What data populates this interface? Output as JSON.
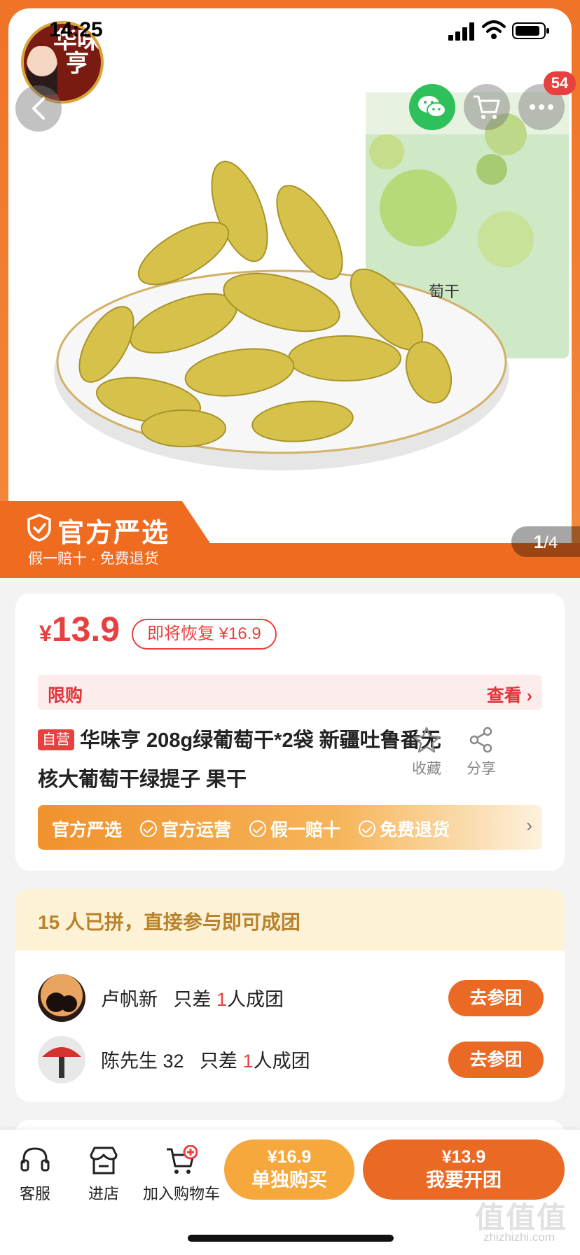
{
  "status_bar": {
    "time": "14:25"
  },
  "header": {
    "logo_text": "华味亨",
    "cart_badge": "54",
    "icons": [
      "back-icon",
      "wechat-icon",
      "cart-icon",
      "more-icon"
    ]
  },
  "hero": {
    "banner_title": "官方严选",
    "banner_sub": "假一赔十 · 免费退货",
    "pager_current": "1",
    "pager_total": "/4",
    "package_text": "萄干"
  },
  "price_card": {
    "currency": "¥",
    "price": "13.9",
    "restore_tag": "即将恢复 ¥16.9",
    "limit_label": "限购",
    "limit_view": "查看 ›",
    "self_tag": "自营",
    "title": "华味亨 208g绿葡萄干*2袋 新疆吐鲁番无核大葡萄干绿提子 果干",
    "favorite_label": "收藏",
    "share_label": "分享",
    "promo": {
      "brand": "官方严选",
      "items": [
        "官方运营",
        "假一赔十",
        "免费退货"
      ],
      "arrow": "›"
    }
  },
  "group_card": {
    "header": "15 人已拼，直接参与即可成团",
    "rows": [
      {
        "name": "卢帆新",
        "prefix": "只差",
        "count": "1",
        "suffix": "人成团",
        "button": "去参团"
      },
      {
        "name": "陈先生 32",
        "prefix": "只差",
        "count": "1",
        "suffix": "人成团",
        "button": "去参团"
      }
    ]
  },
  "bottom_bar": {
    "service_label": "客服",
    "store_label": "进店",
    "cart_label": "加入购物车",
    "solo_price": "¥16.9",
    "solo_label": "单独购买",
    "group_price": "¥13.9",
    "group_label": "我要开团"
  },
  "watermark": {
    "main": "值值值",
    "sub": "zhizhizhi.com"
  },
  "colors": {
    "accent_red": "#e8403e",
    "orange": "#ea6a25",
    "light_orange": "#f6a83d",
    "wechat_green": "#2ec05a"
  }
}
